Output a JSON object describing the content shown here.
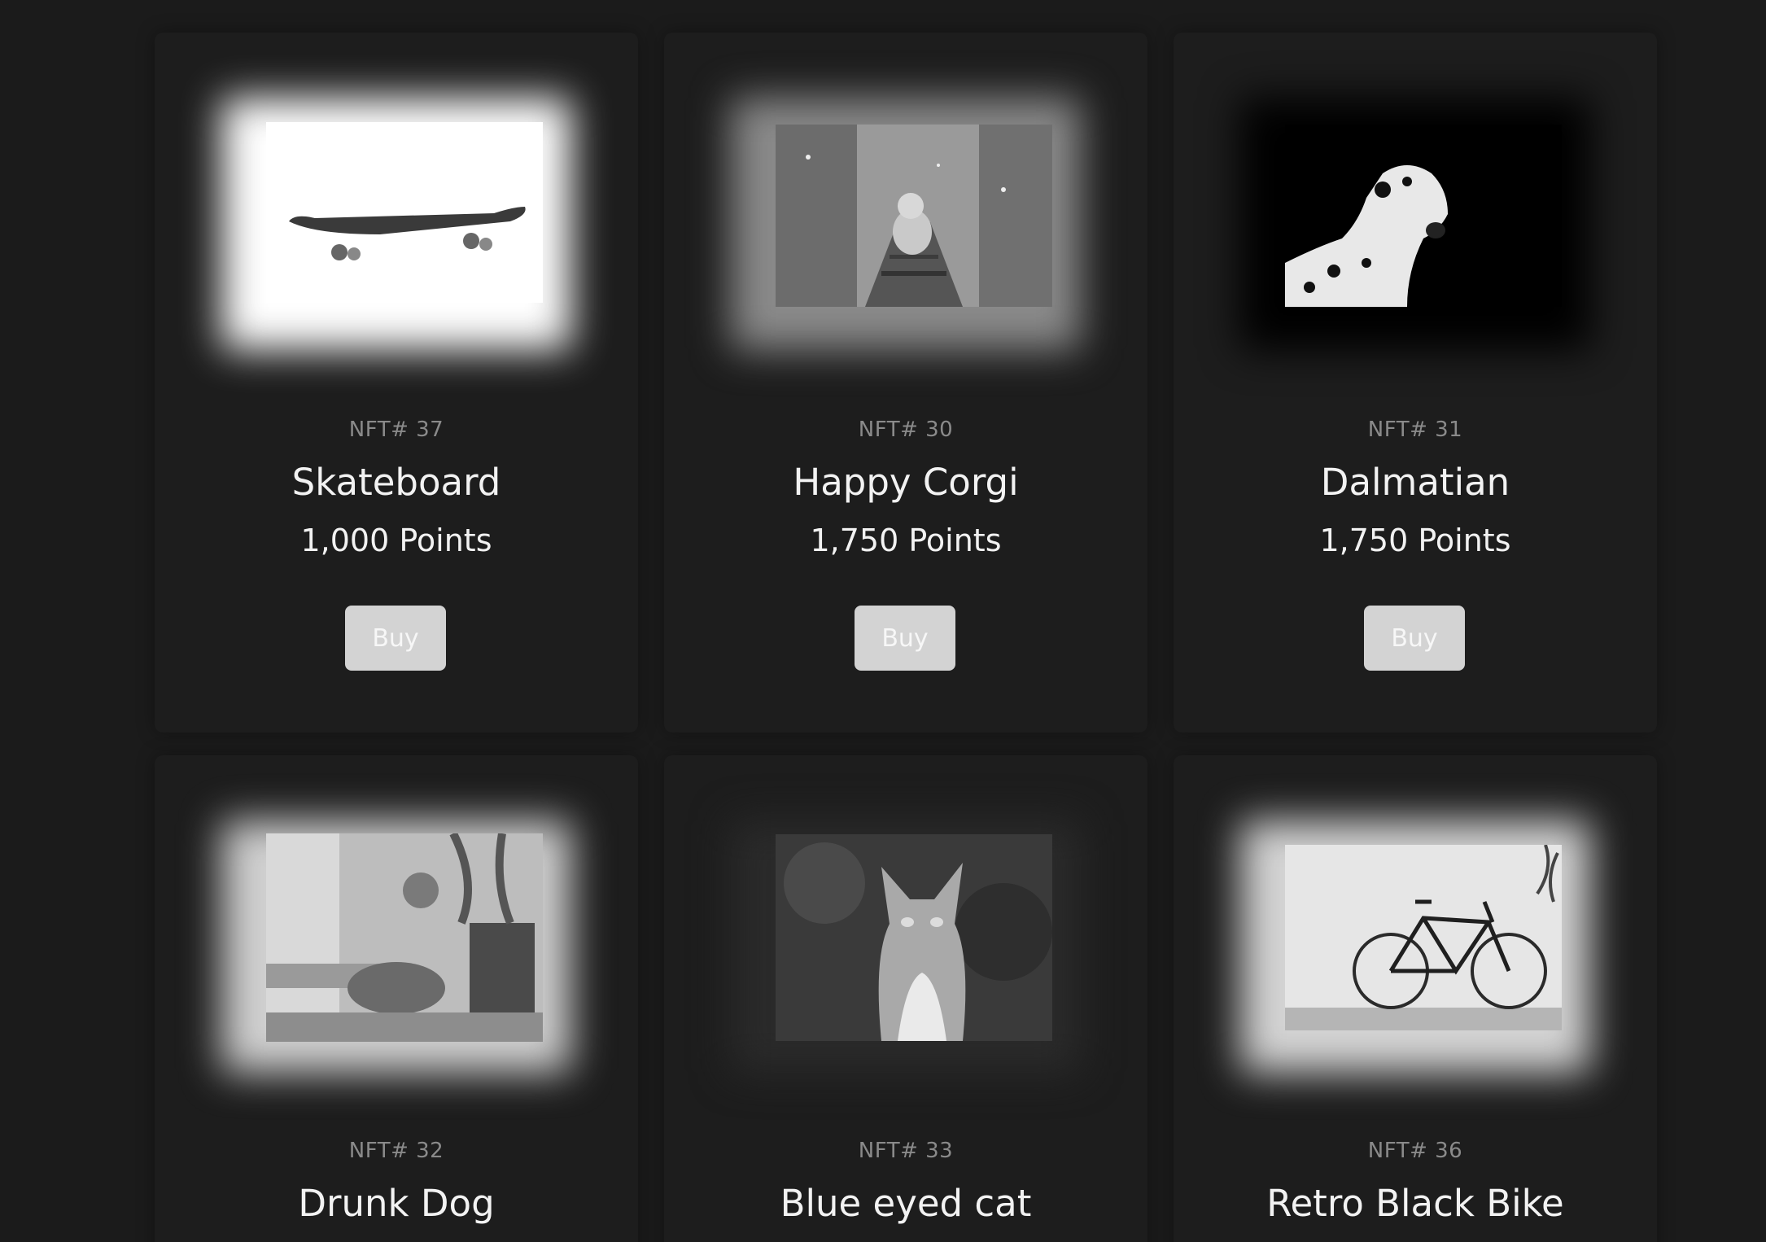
{
  "cards": [
    {
      "id_label": "NFT# 37",
      "name": "Skateboard",
      "price": "1,000 Points",
      "buy_label": "Buy",
      "image": "skateboard-photo"
    },
    {
      "id_label": "NFT# 30",
      "name": "Happy Corgi",
      "price": "1,750 Points",
      "buy_label": "Buy",
      "image": "corgi-photo"
    },
    {
      "id_label": "NFT# 31",
      "name": "Dalmatian",
      "price": "1,750 Points",
      "buy_label": "Buy",
      "image": "dalmatian-photo"
    },
    {
      "id_label": "NFT# 32",
      "name": "Drunk Dog",
      "image": "sleeping-dog-photo"
    },
    {
      "id_label": "NFT# 33",
      "name": "Blue eyed cat",
      "image": "cat-photo"
    },
    {
      "id_label": "NFT# 36",
      "name": "Retro Black Bike",
      "image": "bicycle-photo"
    }
  ],
  "colors": {
    "background": "#1b1b1b",
    "card": "#1d1d1d",
    "button": "#d3d3d3",
    "text_primary": "#f2f2f2",
    "text_muted": "#8a8a8a"
  }
}
